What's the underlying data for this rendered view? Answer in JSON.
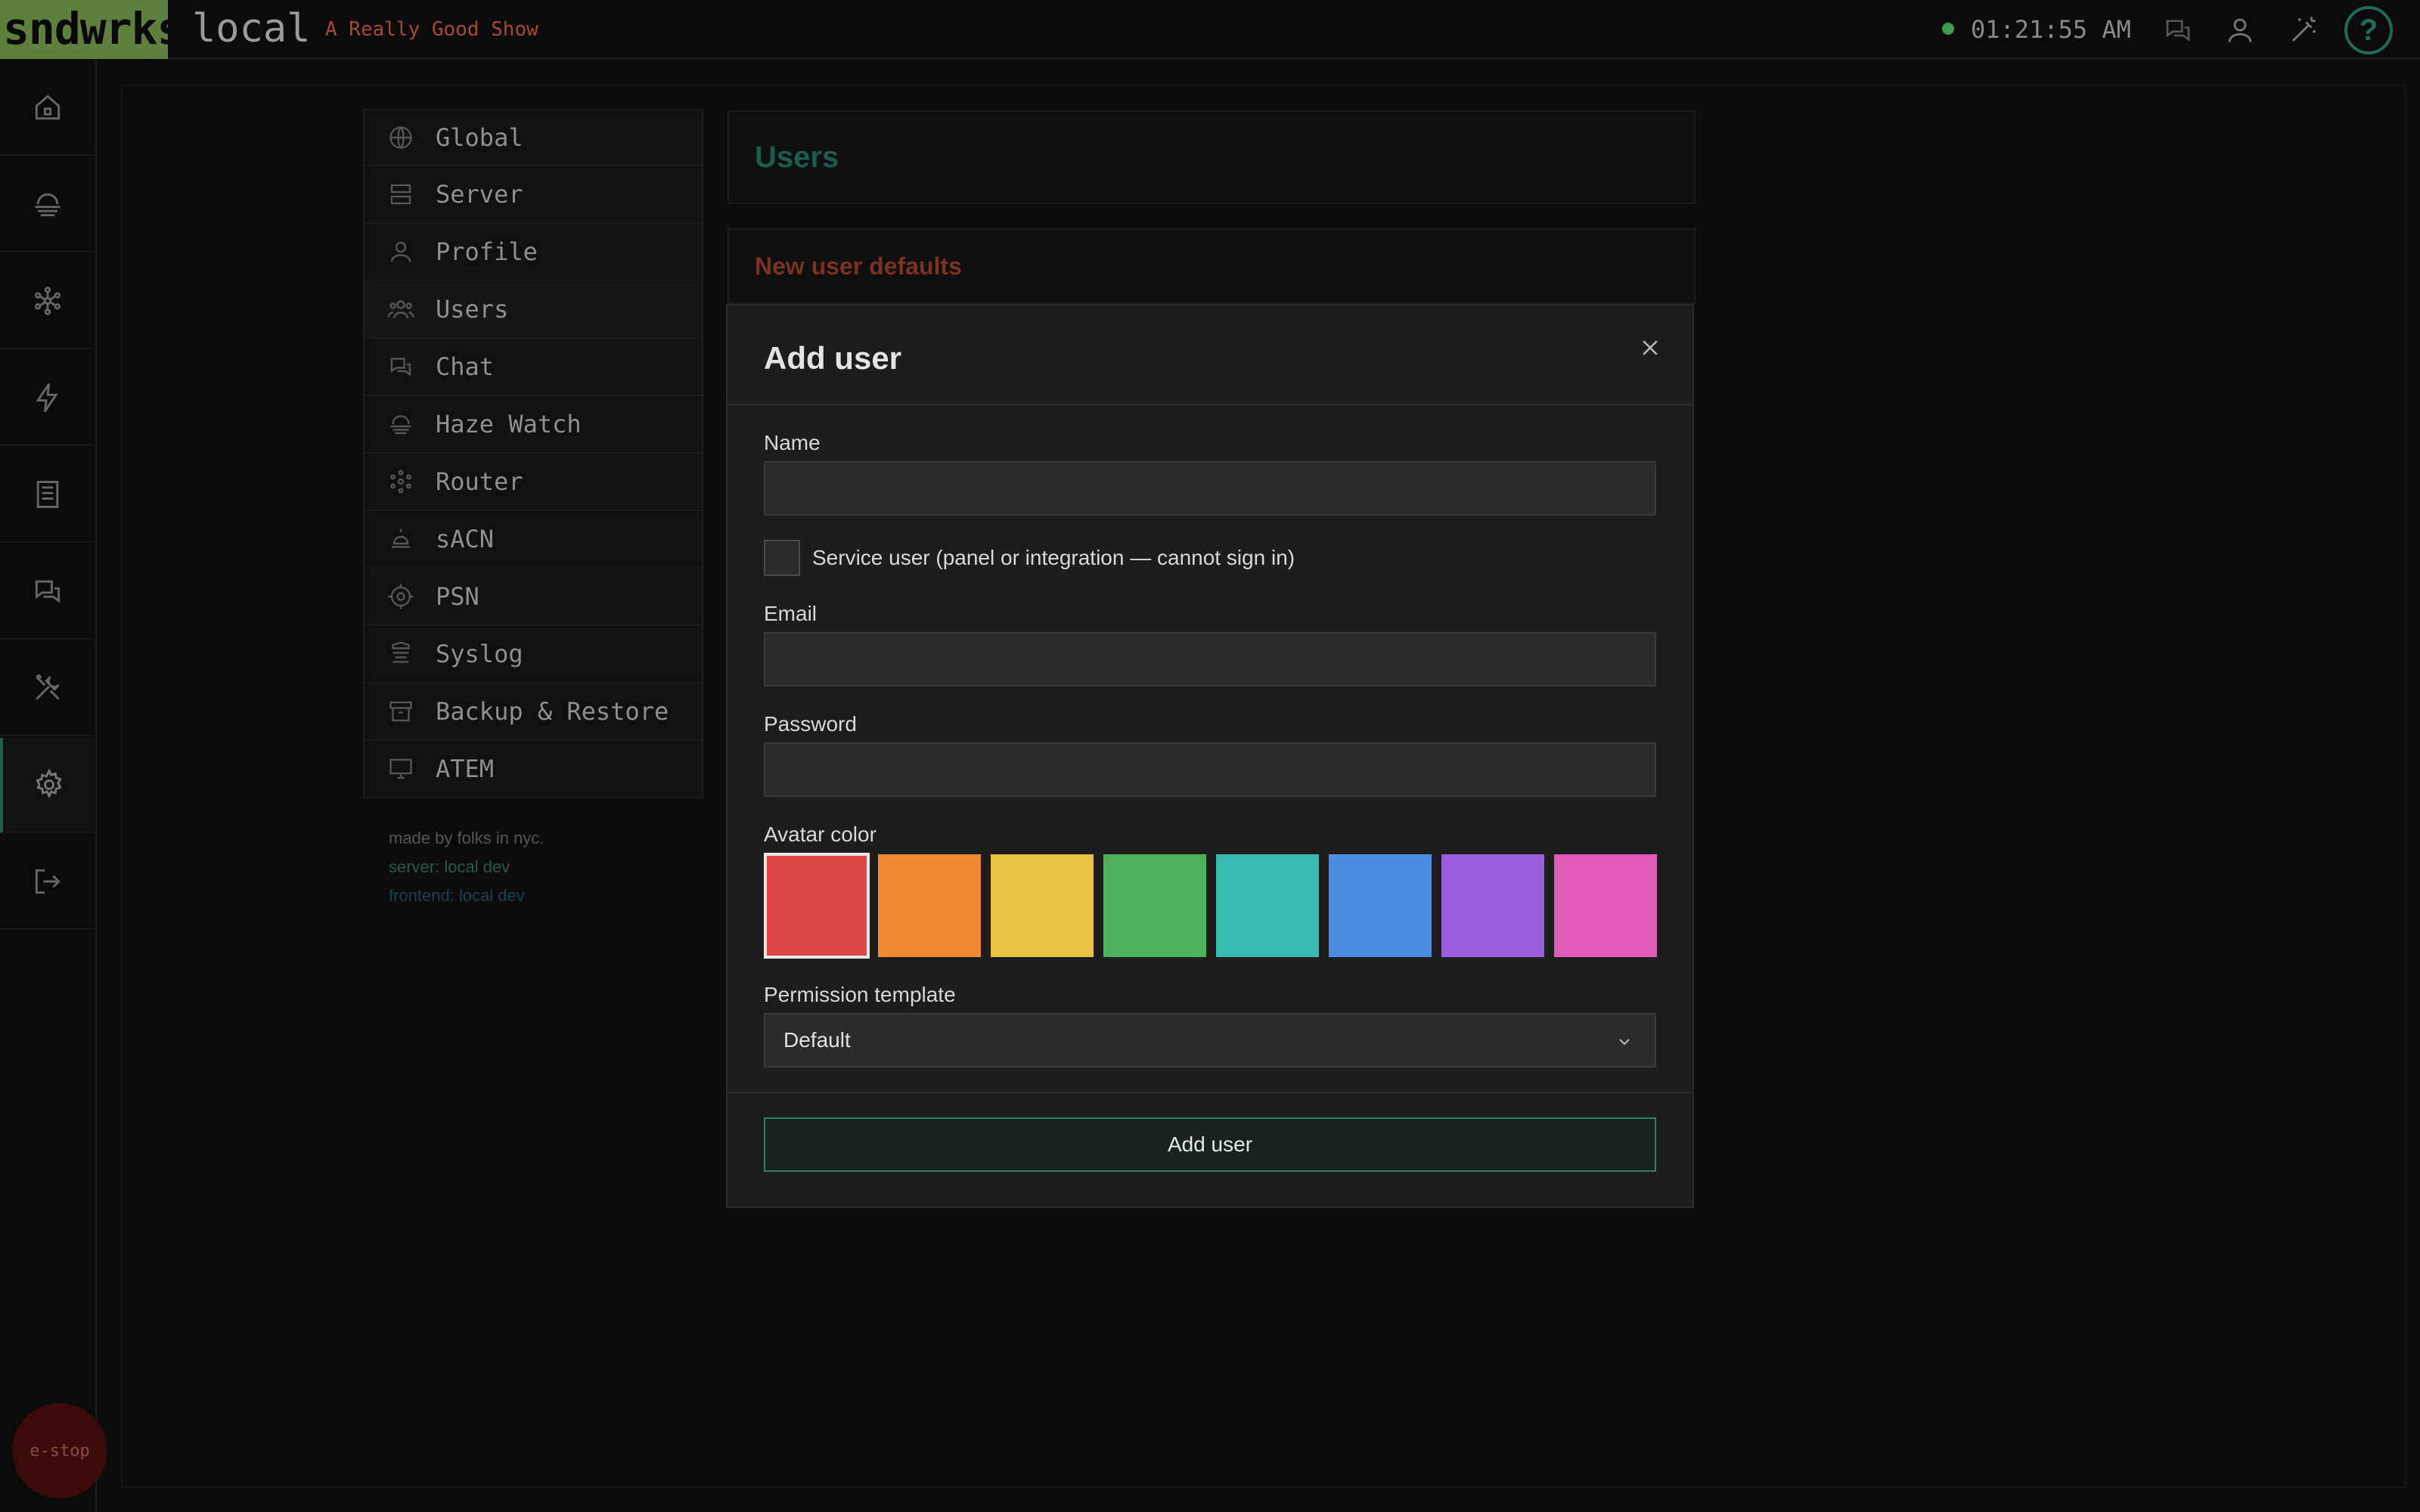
{
  "topbar": {
    "logo": "sndwrks",
    "environment": "local",
    "show_name": "A Really Good Show",
    "clock": "01:21:55 AM",
    "status_color": "#3f9b4f",
    "icons": [
      "chat-icon",
      "user-icon",
      "magic-wand-icon",
      "help-icon"
    ],
    "help_label": "?"
  },
  "rail": {
    "items": [
      "home-icon",
      "haze-icon",
      "router-icon",
      "lightning-icon",
      "document-icon",
      "chat-icon",
      "tools-icon",
      "gear-icon",
      "logout-icon"
    ],
    "active_index": 7,
    "estop_label": "e-stop"
  },
  "settings_nav": {
    "items": [
      {
        "label": "Global",
        "icon": "globe-icon"
      },
      {
        "label": "Server",
        "icon": "server-icon"
      },
      {
        "label": "Profile",
        "icon": "user-icon"
      },
      {
        "label": "Users",
        "icon": "users-icon"
      },
      {
        "label": "Chat",
        "icon": "chat-icon"
      },
      {
        "label": "Haze Watch",
        "icon": "haze-icon"
      },
      {
        "label": "Router",
        "icon": "router-icon"
      },
      {
        "label": "sACN",
        "icon": "light-icon"
      },
      {
        "label": "PSN",
        "icon": "target-icon"
      },
      {
        "label": "Syslog",
        "icon": "log-icon"
      },
      {
        "label": "Backup & Restore",
        "icon": "archive-icon"
      },
      {
        "label": "ATEM",
        "icon": "monitor-icon"
      }
    ],
    "active_index": 3,
    "footer": {
      "credit": "made by folks in nyc.",
      "server": "server: local dev",
      "frontend": "frontend: local dev"
    }
  },
  "main": {
    "users_title": "Users",
    "defaults_title": "New user defaults"
  },
  "modal": {
    "title": "Add user",
    "name_label": "Name",
    "name_value": "",
    "service_user_label": "Service user (panel or integration — cannot sign in)",
    "service_user_checked": false,
    "email_label": "Email",
    "email_value": "",
    "password_label": "Password",
    "password_value": "",
    "avatar_label": "Avatar color",
    "avatar_colors": [
      "#e04848",
      "#ee8a35",
      "#e8c23e",
      "#4caf5a",
      "#34bbae",
      "#4a8ce0",
      "#9a5ddc",
      "#e05ab8"
    ],
    "avatar_selected_index": 0,
    "permission_label": "Permission template",
    "permission_value": "Default",
    "submit_label": "Add user"
  }
}
